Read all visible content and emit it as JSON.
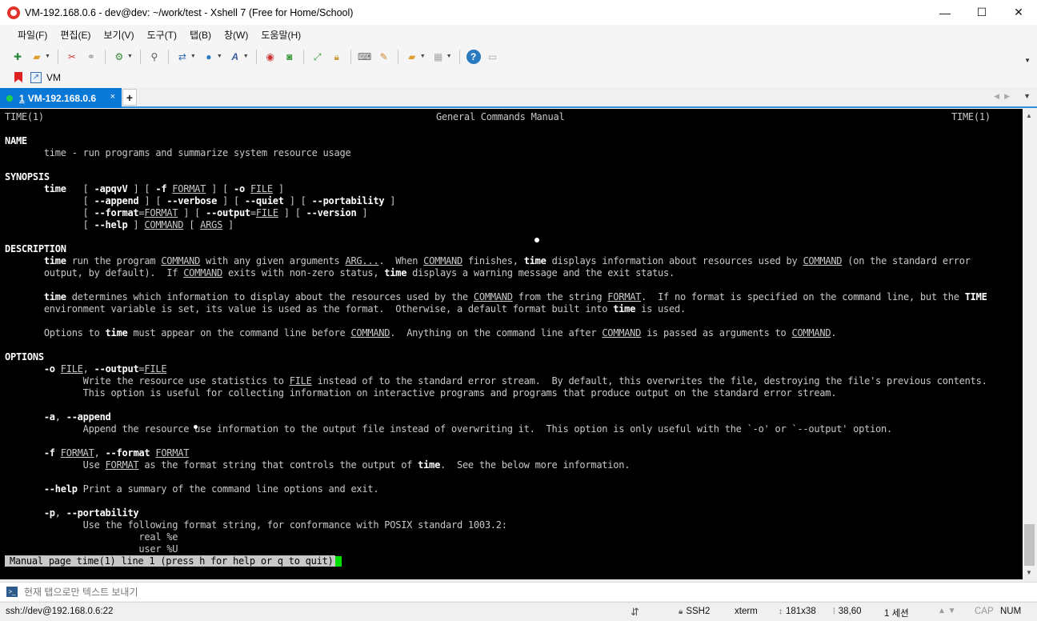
{
  "window": {
    "title": "VM-192.168.0.6 - dev@dev: ~/work/test - Xshell 7 (Free for Home/School)",
    "minimize": "—",
    "maximize": "☐",
    "close": "✕"
  },
  "menu": [
    "파일(F)",
    "편집(E)",
    "보기(V)",
    "도구(T)",
    "탭(B)",
    "창(W)",
    "도움말(H)"
  ],
  "links": {
    "vm_label": "VM"
  },
  "tab": {
    "number": "1",
    "label": "VM-192.168.0.6",
    "close": "×",
    "add": "+"
  },
  "terminal": {
    "header_left": "TIME(1)",
    "header_center": "General Commands Manual",
    "header_right": "TIME(1)",
    "name_heading": "NAME",
    "name_body": "time - run programs and summarize system resource usage",
    "synopsis_heading": "SYNOPSIS",
    "description_heading": "DESCRIPTION",
    "options_heading": "OPTIONS",
    "status_line": "Manual page time(1) line 1 (press h for help or q to quit)"
  },
  "compose": {
    "placeholder": "현재 탭으로만 텍스트 보내기"
  },
  "status": {
    "connection": "ssh://dev@192.168.0.6:22",
    "protocol": "SSH2",
    "terminal_type": "xterm",
    "size": "181x38",
    "cursor_pos": "38,60",
    "sessions": "1 세션",
    "cap": "CAP",
    "num": "NUM"
  },
  "colors": {
    "tab_active": "#0a78d7",
    "terminal_bg": "#000000",
    "cursor": "#00e000",
    "connected_dot": "#1fd14c"
  },
  "icons": [
    "new-session-icon",
    "open-folder-icon",
    "disconnect-icon",
    "reconnect-icon",
    "properties-icon",
    "find-icon",
    "transfer-icon",
    "globe-icon",
    "font-icon",
    "xshell-icon",
    "xftp-icon",
    "fullscreen-icon",
    "lock-icon",
    "keyboard-icon",
    "highlighter-icon",
    "new-folder-icon",
    "layout-icon",
    "help-icon",
    "chat-icon"
  ]
}
